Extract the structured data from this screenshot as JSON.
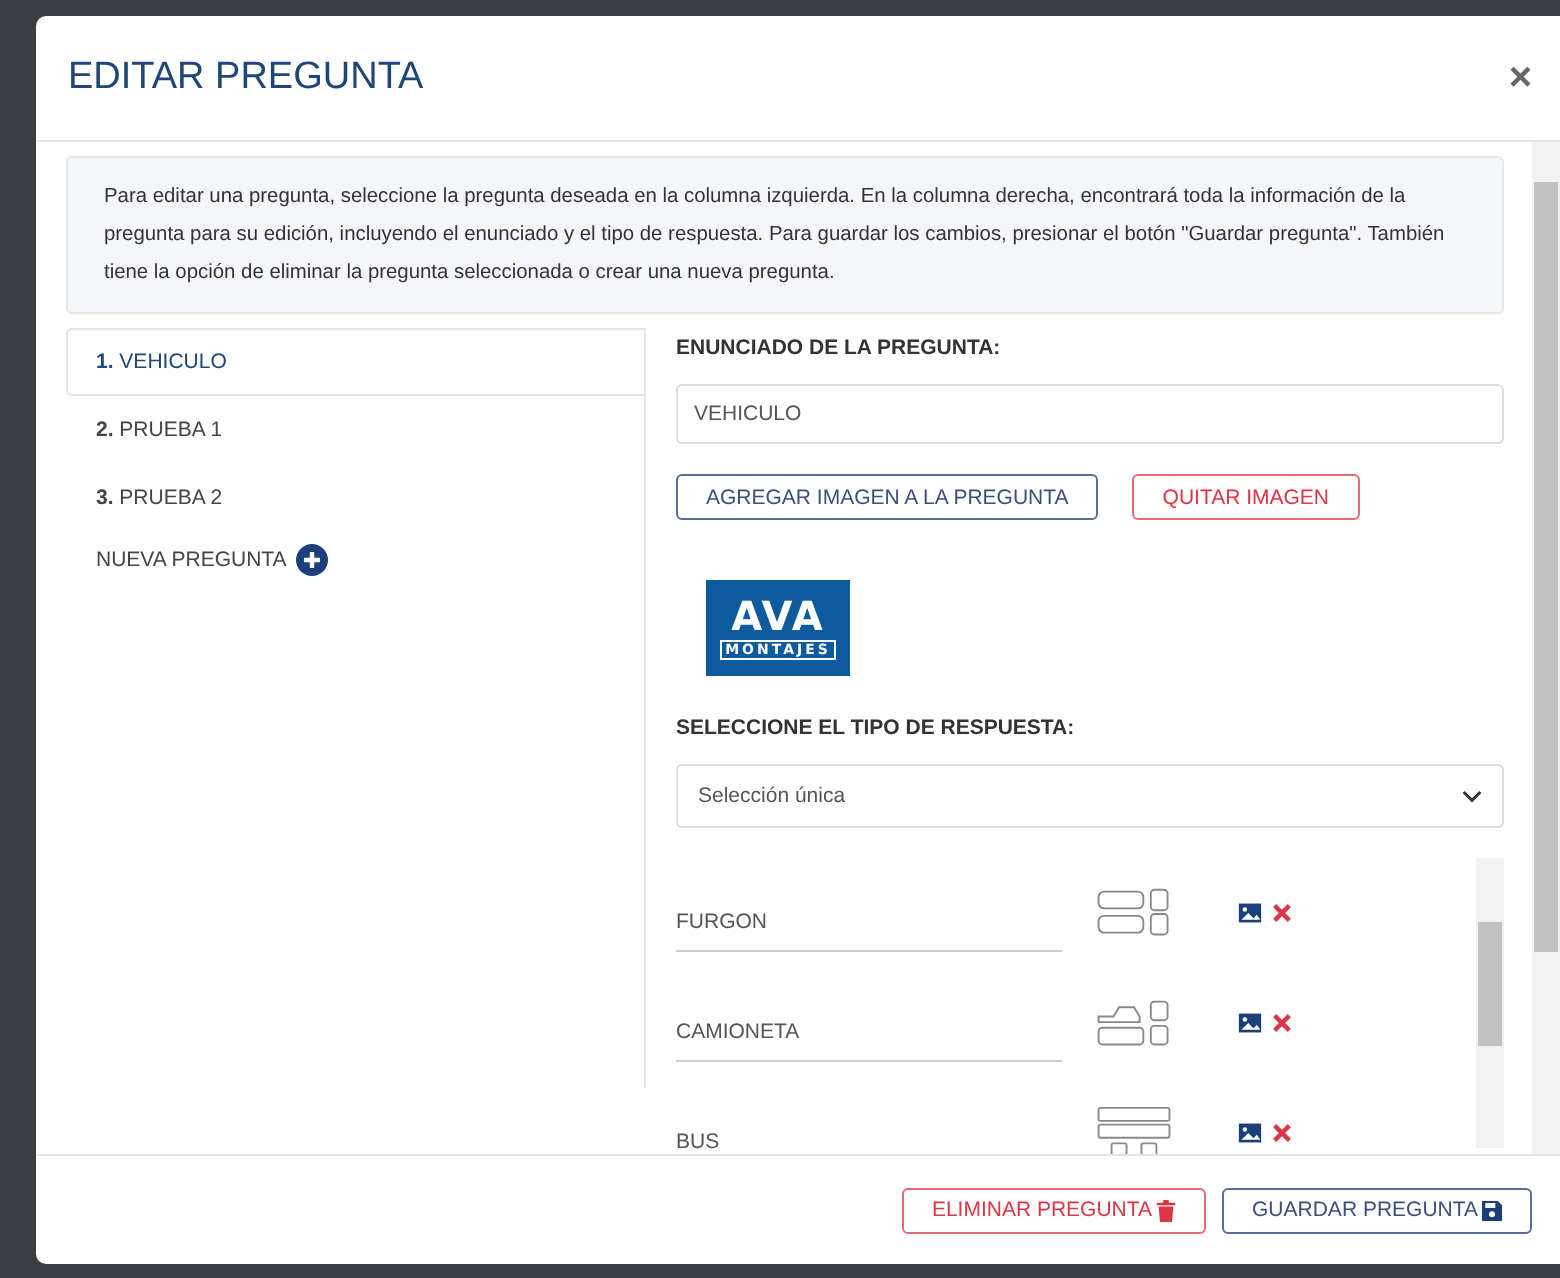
{
  "modal": {
    "title": "EDITAR PREGUNTA",
    "close": "×"
  },
  "info": "Para editar una pregunta, seleccione la pregunta deseada en la columna izquierda. En la columna derecha, encontrará toda la información de la pregunta para su edición, incluyendo el enunciado y el tipo de respuesta. Para guardar los cambios, presionar el botón \"Guardar pregunta\". También tiene la opción de eliminar la pregunta seleccionada o crear una nueva pregunta.",
  "questions": [
    {
      "label": "**1.** VEHICULO",
      "selected": true
    },
    {
      "label": "**2.** PRUEBA 1",
      "selected": false
    },
    {
      "label": "**3.** PRUEBA 2",
      "selected": false
    }
  ],
  "new_question": "NUEVA PREGUNTA",
  "statement": {
    "label": "ENUNCIADO DE LA PREGUNTA:",
    "value": "VEHICULO"
  },
  "image_buttons": {
    "add": "AGREGAR IMAGEN A LA PREGUNTA",
    "remove": "QUITAR IMAGEN"
  },
  "logo": {
    "mark": "AVA",
    "caption": "MONTAJES"
  },
  "answer_type": {
    "label": "SELECCIONE EL TIPO DE RESPUESTA:",
    "value": "Selección única"
  },
  "answers": [
    {
      "value": "FURGON",
      "kind": "van"
    },
    {
      "value": "CAMIONETA",
      "kind": "pickup"
    },
    {
      "value": "BUS",
      "kind": "bus"
    }
  ],
  "footer": {
    "delete": "ELIMINAR PREGUNTA",
    "save": "GUARDAR PREGUNTA"
  }
}
